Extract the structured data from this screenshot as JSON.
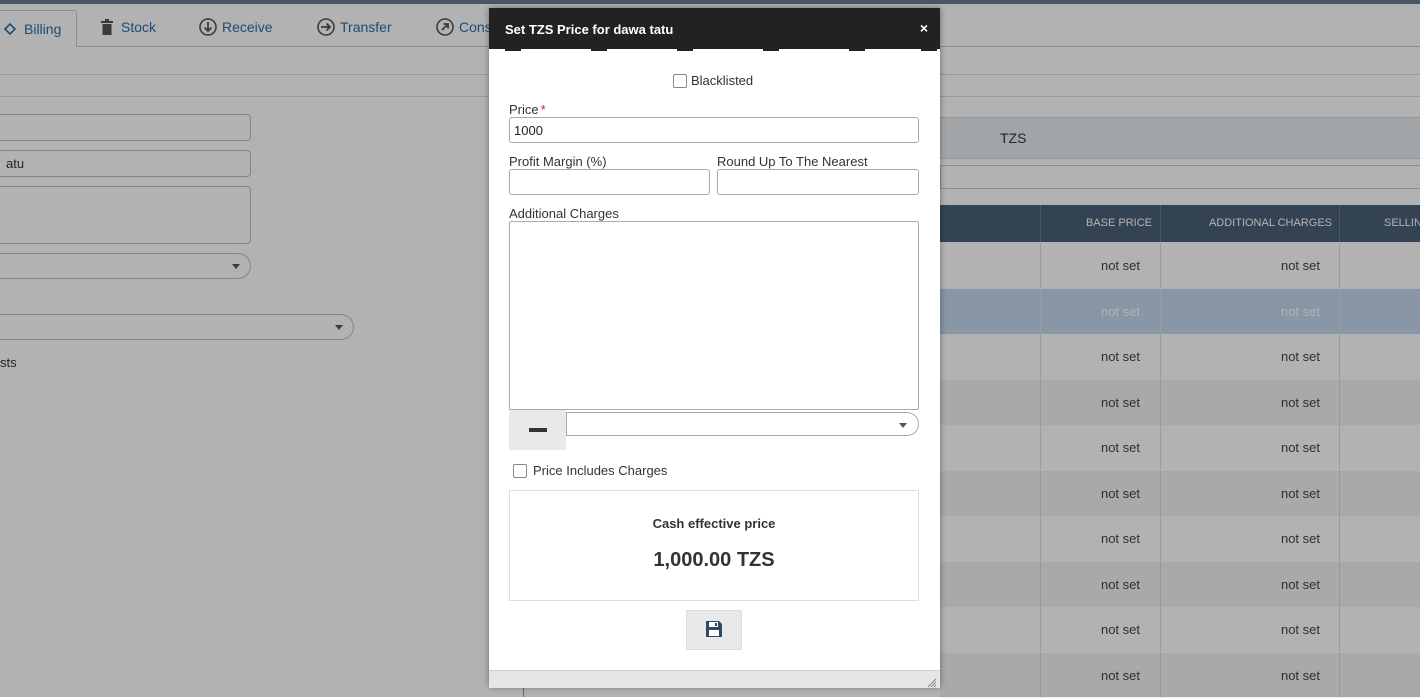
{
  "tabs": [
    {
      "label": "Billing",
      "icon": "billing-icon",
      "active": true
    },
    {
      "label": "Stock",
      "icon": "trash-icon"
    },
    {
      "label": "Receive",
      "icon": "arrow-down-circle-icon"
    },
    {
      "label": "Transfer",
      "icon": "arrow-right-circle-icon"
    },
    {
      "label": "Cons",
      "icon": "arrow-up-right-circle-icon"
    }
  ],
  "background": {
    "name_field_value": "atu",
    "checkbox_label_fragment": "sts",
    "currency_label": "TZS",
    "grid": {
      "columns": [
        "BASE PRICE",
        "ADDITIONAL CHARGES",
        "SELLIN"
      ],
      "rows": [
        {
          "base_price": "not set",
          "additional_charges": "not set"
        },
        {
          "base_price": "not set",
          "additional_charges": "not set",
          "selected": true
        },
        {
          "base_price": "not set",
          "additional_charges": "not set"
        },
        {
          "base_price": "not set",
          "additional_charges": "not set"
        },
        {
          "base_price": "not set",
          "additional_charges": "not set"
        },
        {
          "base_price": "not set",
          "additional_charges": "not set"
        },
        {
          "base_price": "not set",
          "additional_charges": "not set"
        },
        {
          "base_price": "not set",
          "additional_charges": "not set"
        },
        {
          "base_price": "not set",
          "additional_charges": "not set"
        },
        {
          "base_price": "not set",
          "additional_charges": "not set"
        }
      ]
    }
  },
  "dialog": {
    "title": "Set TZS Price for dawa tatu",
    "close_symbol": "×",
    "blacklisted_label": "Blacklisted",
    "price_label": "Price",
    "required_mark": "*",
    "price_value": "1000",
    "profit_margin_label": "Profit Margin (%)",
    "profit_margin_value": "",
    "round_up_label": "Round Up To The Nearest",
    "round_up_value": "",
    "additional_charges_label": "Additional Charges",
    "price_includes_charges_label": "Price Includes Charges",
    "cash_effective_title": "Cash effective price",
    "cash_effective_value": "1,000.00 TZS"
  },
  "colors": {
    "accent_link": "#2a6ea6",
    "title_bar": "#222222",
    "grid_header": "#4a6079",
    "selected_row": "#c3d7ec",
    "required": "#d9251d"
  }
}
